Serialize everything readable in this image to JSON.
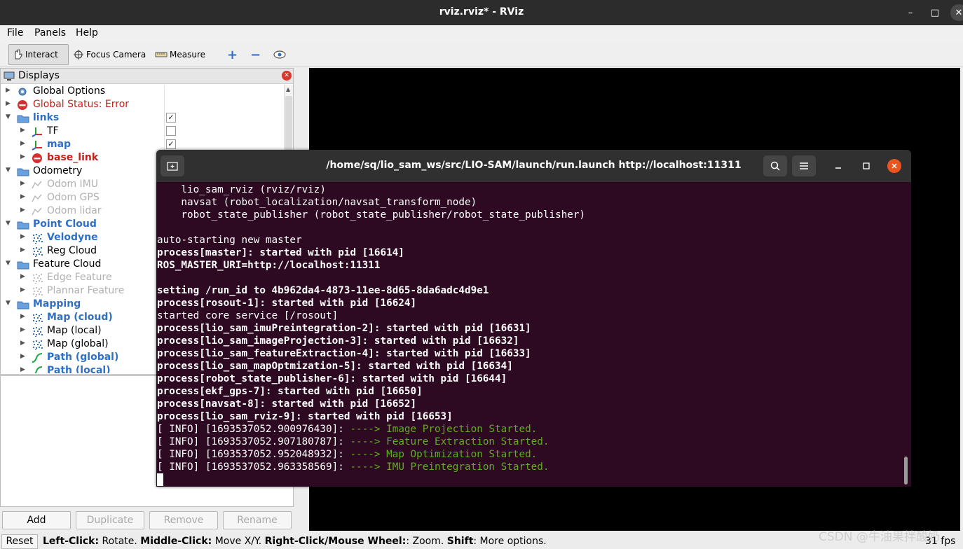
{
  "window": {
    "title": "rviz.rviz* - RViz",
    "controls": {
      "minimize": "–",
      "maximize": "□",
      "close": "✕"
    }
  },
  "menu": {
    "items": [
      "File",
      "Panels",
      "Help"
    ]
  },
  "toolbar": {
    "interact": "Interact",
    "focus_camera": "Focus Camera",
    "measure": "Measure",
    "add_icon": "+",
    "remove_icon": "−",
    "view_icon": "eye-icon"
  },
  "displays": {
    "header": "Displays",
    "rows": [
      {
        "label": "Global Options",
        "icon": "gear-icon"
      },
      {
        "label": "Global Status: Error",
        "icon": "error-icon"
      },
      {
        "label": "links",
        "icon": "folder-icon",
        "checked": true
      },
      {
        "label": "TF",
        "icon": "axes-icon",
        "checked": false
      },
      {
        "label": "map",
        "icon": "axes-icon",
        "checked": true
      },
      {
        "label": "base_link",
        "icon": "error-icon"
      },
      {
        "label": "Odometry",
        "icon": "folder-icon"
      },
      {
        "label": "Odom IMU",
        "icon": "odometry-icon"
      },
      {
        "label": "Odom GPS",
        "icon": "odometry-icon"
      },
      {
        "label": "Odom lidar",
        "icon": "odometry-icon"
      },
      {
        "label": "Point Cloud",
        "icon": "folder-icon"
      },
      {
        "label": "Velodyne",
        "icon": "pointcloud-icon"
      },
      {
        "label": "Reg Cloud",
        "icon": "pointcloud-icon"
      },
      {
        "label": "Feature Cloud",
        "icon": "folder-icon"
      },
      {
        "label": "Edge Feature",
        "icon": "pointcloud-icon"
      },
      {
        "label": "Plannar Feature",
        "icon": "pointcloud-icon"
      },
      {
        "label": "Mapping",
        "icon": "folder-icon"
      },
      {
        "label": "Map (cloud)",
        "icon": "pointcloud-icon"
      },
      {
        "label": "Map (local)",
        "icon": "pointcloud-icon"
      },
      {
        "label": "Map (global)",
        "icon": "pointcloud-icon"
      },
      {
        "label": "Path (global)",
        "icon": "path-icon"
      },
      {
        "label": "Path (local)",
        "icon": "path-icon"
      }
    ]
  },
  "buttons": {
    "add": "Add",
    "duplicate": "Duplicate",
    "remove": "Remove",
    "rename": "Rename"
  },
  "status": {
    "reset": "Reset",
    "help_parts": [
      {
        "t": "Left-Click:",
        "b": true
      },
      {
        "t": " Rotate. ",
        "b": false
      },
      {
        "t": "Middle-Click:",
        "b": true
      },
      {
        "t": " Move X/Y. ",
        "b": false
      },
      {
        "t": "Right-Click/Mouse Wheel:",
        "b": true
      },
      {
        "t": ": Zoom. ",
        "b": false
      },
      {
        "t": "Shift",
        "b": true
      },
      {
        "t": ": More options.",
        "b": false
      }
    ],
    "fps": "31 fps"
  },
  "watermark": "CSDN @牛油果拌酸奶",
  "terminal": {
    "title": "/home/sq/lio_sam_ws/src/LIO-SAM/launch/run.launch http://localhost:11311",
    "lines": [
      {
        "text": "    lio_sam_rviz (rviz/rviz)",
        "bold": false
      },
      {
        "text": "    navsat (robot_localization/navsat_transform_node)",
        "bold": false
      },
      {
        "text": "    robot_state_publisher (robot_state_publisher/robot_state_publisher)",
        "bold": false
      },
      {
        "text": "",
        "bold": false
      },
      {
        "text": "auto-starting new master",
        "bold": false
      },
      {
        "text": "process[master]: started with pid [16614]",
        "bold": true
      },
      {
        "text": "ROS_MASTER_URI=http://localhost:11311",
        "bold": true
      },
      {
        "text": "",
        "bold": false
      },
      {
        "text": "setting /run_id to 4b962da4-4873-11ee-8d65-8da6adc4d9e1",
        "bold": true
      },
      {
        "text": "process[rosout-1]: started with pid [16624]",
        "bold": true
      },
      {
        "text": "started core service [/rosout]",
        "bold": false
      },
      {
        "text": "process[lio_sam_imuPreintegration-2]: started with pid [16631]",
        "bold": true
      },
      {
        "text": "process[lio_sam_imageProjection-3]: started with pid [16632]",
        "bold": true
      },
      {
        "text": "process[lio_sam_featureExtraction-4]: started with pid [16633]",
        "bold": true
      },
      {
        "text": "process[lio_sam_mapOptmization-5]: started with pid [16634]",
        "bold": true
      },
      {
        "text": "process[robot_state_publisher-6]: started with pid [16644]",
        "bold": true
      },
      {
        "text": "process[ekf_gps-7]: started with pid [16650]",
        "bold": true
      },
      {
        "text": "process[navsat-8]: started with pid [16652]",
        "bold": true
      },
      {
        "text": "process[lio_sam_rviz-9]: started with pid [16653]",
        "bold": true
      }
    ],
    "info_lines": [
      {
        "prefix": "[ INFO] [1693537052.900976430]: ",
        "msg": "----> Image Projection Started."
      },
      {
        "prefix": "[ INFO] [1693537052.907180787]: ",
        "msg": "----> Feature Extraction Started."
      },
      {
        "prefix": "[ INFO] [1693537052.952048932]: ",
        "msg": "----> Map Optimization Started."
      },
      {
        "prefix": "[ INFO] [1693537052.963358569]: ",
        "msg": "----> IMU Preintegration Started."
      }
    ]
  }
}
